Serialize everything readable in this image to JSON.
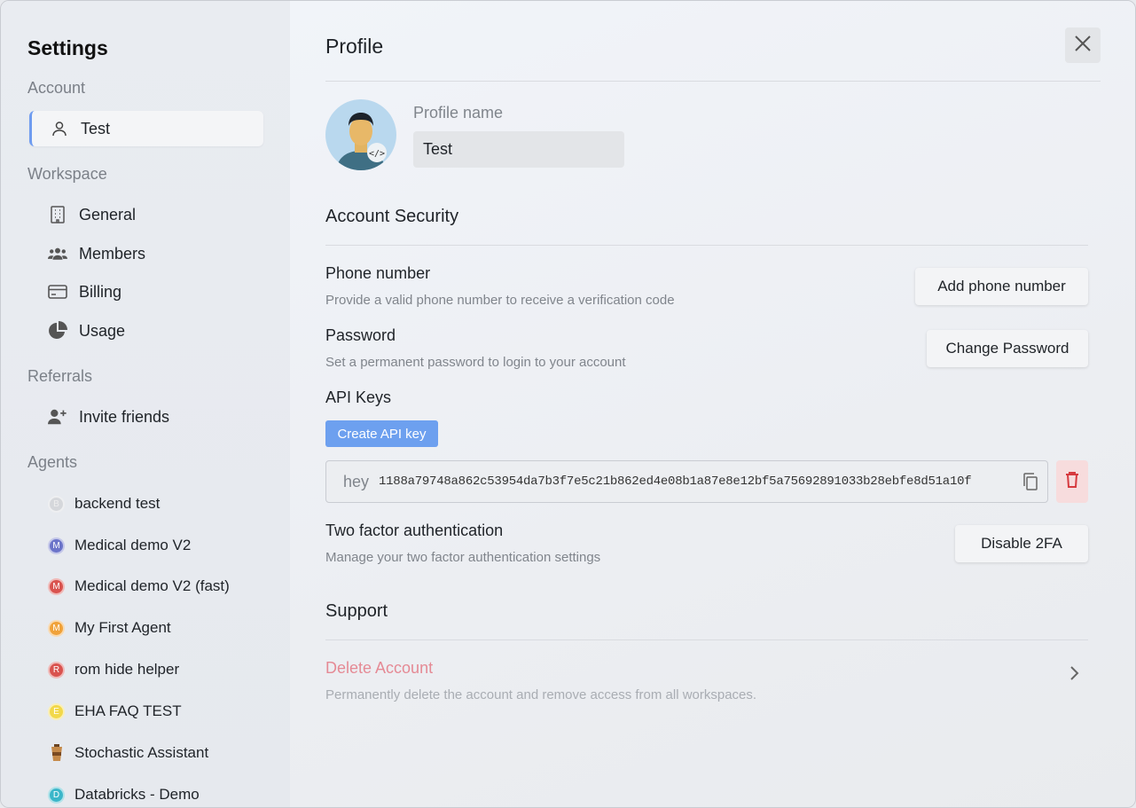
{
  "sidebar": {
    "title": "Settings",
    "sections": {
      "account": "Account",
      "workspace": "Workspace",
      "referrals": "Referrals",
      "agents": "Agents"
    },
    "account_item": {
      "label": "Test",
      "icon": "user-icon"
    },
    "workspace_items": [
      {
        "label": "General",
        "icon": "building-icon"
      },
      {
        "label": "Members",
        "icon": "users-icon"
      },
      {
        "label": "Billing",
        "icon": "credit-card-icon"
      },
      {
        "label": "Usage",
        "icon": "pie-chart-icon"
      }
    ],
    "referral_item": {
      "label": "Invite friends",
      "icon": "user-plus-icon"
    },
    "agents": [
      {
        "label": "backend test",
        "initial": "B",
        "color": "#d5d7db"
      },
      {
        "label": "Medical demo V2",
        "initial": "M",
        "color": "#6b74c9"
      },
      {
        "label": "Medical demo V2 (fast)",
        "initial": "M",
        "color": "#d9534f"
      },
      {
        "label": "My First Agent",
        "initial": "M",
        "color": "#f0a23a"
      },
      {
        "label": "rom hide helper",
        "initial": "R",
        "color": "#d9534f"
      },
      {
        "label": "EHA FAQ TEST",
        "initial": "E",
        "color": "#f2d84a"
      },
      {
        "label": "Stochastic Assistant",
        "initial": "",
        "color": "#8a5a2b"
      },
      {
        "label": "Databricks - Demo",
        "initial": "D",
        "color": "#3bb6c9"
      }
    ]
  },
  "main": {
    "title": "Profile",
    "profile_name_label": "Profile name",
    "profile_name_value": "Test",
    "security_heading": "Account Security",
    "phone": {
      "title": "Phone number",
      "description": "Provide a valid phone number to receive a verification code",
      "button": "Add phone number"
    },
    "password": {
      "title": "Password",
      "description": "Set a permanent password to login to your account",
      "button": "Change Password"
    },
    "api_keys": {
      "title": "API Keys",
      "create_button": "Create API key",
      "keys": [
        {
          "name": "hey",
          "value": "1188a79748a862c53954da7b3f7e5c21b862ed4e08b1a87e8e12bf5a75692891033b28ebfe8d51a10f"
        }
      ]
    },
    "two_factor": {
      "title": "Two factor authentication",
      "description": "Manage your two factor authentication settings",
      "button": "Disable 2FA"
    },
    "support_heading": "Support",
    "delete_account": {
      "title": "Delete Account",
      "description": "Permanently delete the account and remove access from all workspaces."
    }
  },
  "colors": {
    "accent": "#6da0ef",
    "danger": "#e58a95"
  }
}
